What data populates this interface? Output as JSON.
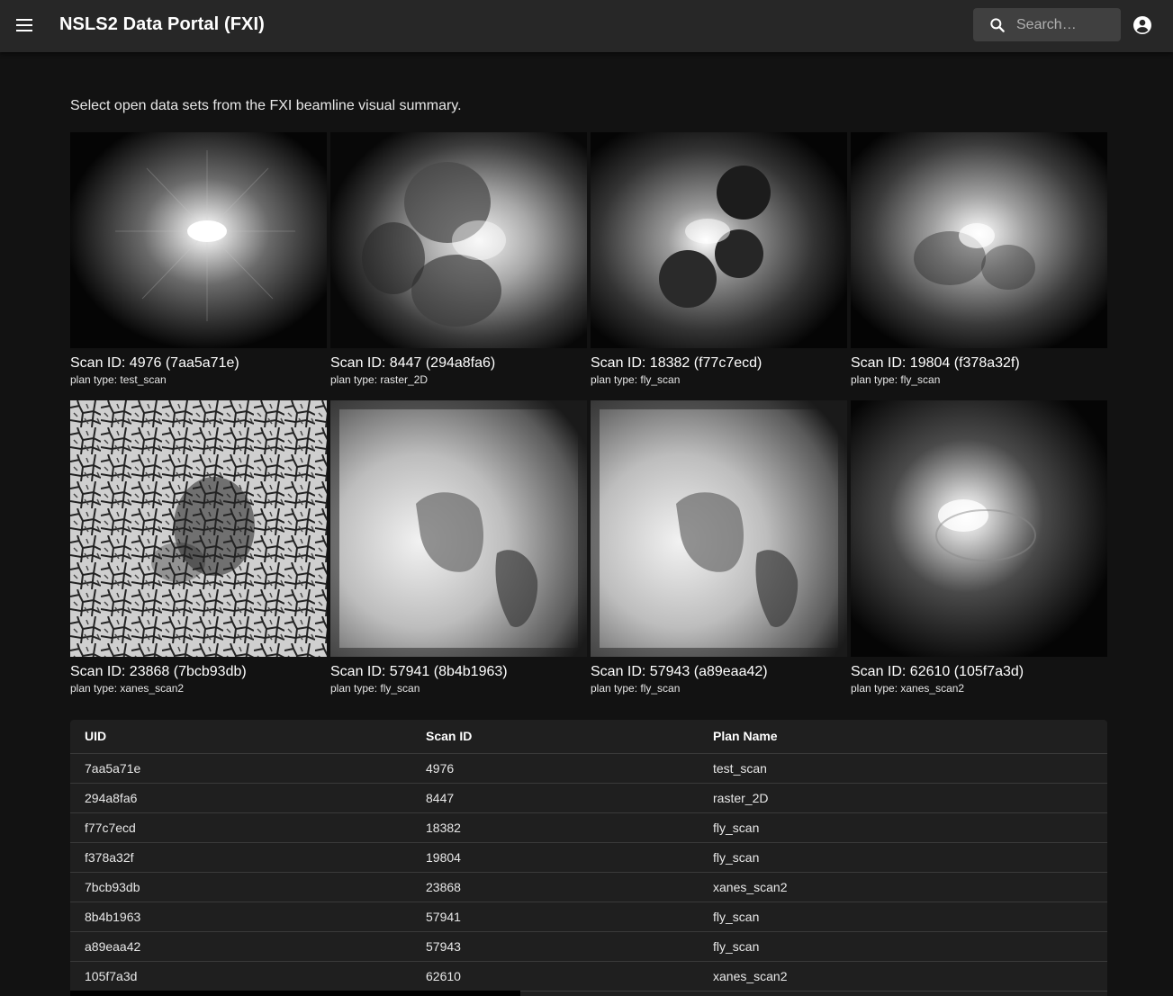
{
  "header": {
    "title": "NSLS2 Data Portal (FXI)",
    "menu_icon": "menu-icon",
    "search_placeholder": "Search…",
    "account_icon": "account-circle-icon"
  },
  "intro_text": "Select open data sets from the FXI beamline visual summary.",
  "cards": [
    {
      "title": "Scan ID: 4976 (7aa5a71e)",
      "plan": "plan type: test_scan"
    },
    {
      "title": "Scan ID: 8447 (294a8fa6)",
      "plan": "plan type: raster_2D"
    },
    {
      "title": "Scan ID: 18382 (f77c7ecd)",
      "plan": "plan type: fly_scan"
    },
    {
      "title": "Scan ID: 19804 (f378a32f)",
      "plan": "plan type: fly_scan"
    },
    {
      "title": "Scan ID: 23868 (7bcb93db)",
      "plan": "plan type: xanes_scan2"
    },
    {
      "title": "Scan ID: 57941 (8b4b1963)",
      "plan": "plan type: fly_scan"
    },
    {
      "title": "Scan ID: 57943 (a89eaa42)",
      "plan": "plan type: fly_scan"
    },
    {
      "title": "Scan ID: 62610 (105f7a3d)",
      "plan": "plan type: xanes_scan2"
    }
  ],
  "table": {
    "headers": [
      "UID",
      "Scan ID",
      "Plan Name"
    ],
    "rows": [
      [
        "7aa5a71e",
        "4976",
        "test_scan"
      ],
      [
        "294a8fa6",
        "8447",
        "raster_2D"
      ],
      [
        "f77c7ecd",
        "18382",
        "fly_scan"
      ],
      [
        "f378a32f",
        "19804",
        "fly_scan"
      ],
      [
        "7bcb93db",
        "23868",
        "xanes_scan2"
      ],
      [
        "8b4b1963",
        "57941",
        "fly_scan"
      ],
      [
        "a89eaa42",
        "57943",
        "fly_scan"
      ],
      [
        "105f7a3d",
        "62610",
        "xanes_scan2"
      ]
    ]
  },
  "colors": {
    "background": "#121212",
    "appbar": "#272727",
    "table_bg": "#1f1f1f",
    "search_bg": "#404040"
  }
}
